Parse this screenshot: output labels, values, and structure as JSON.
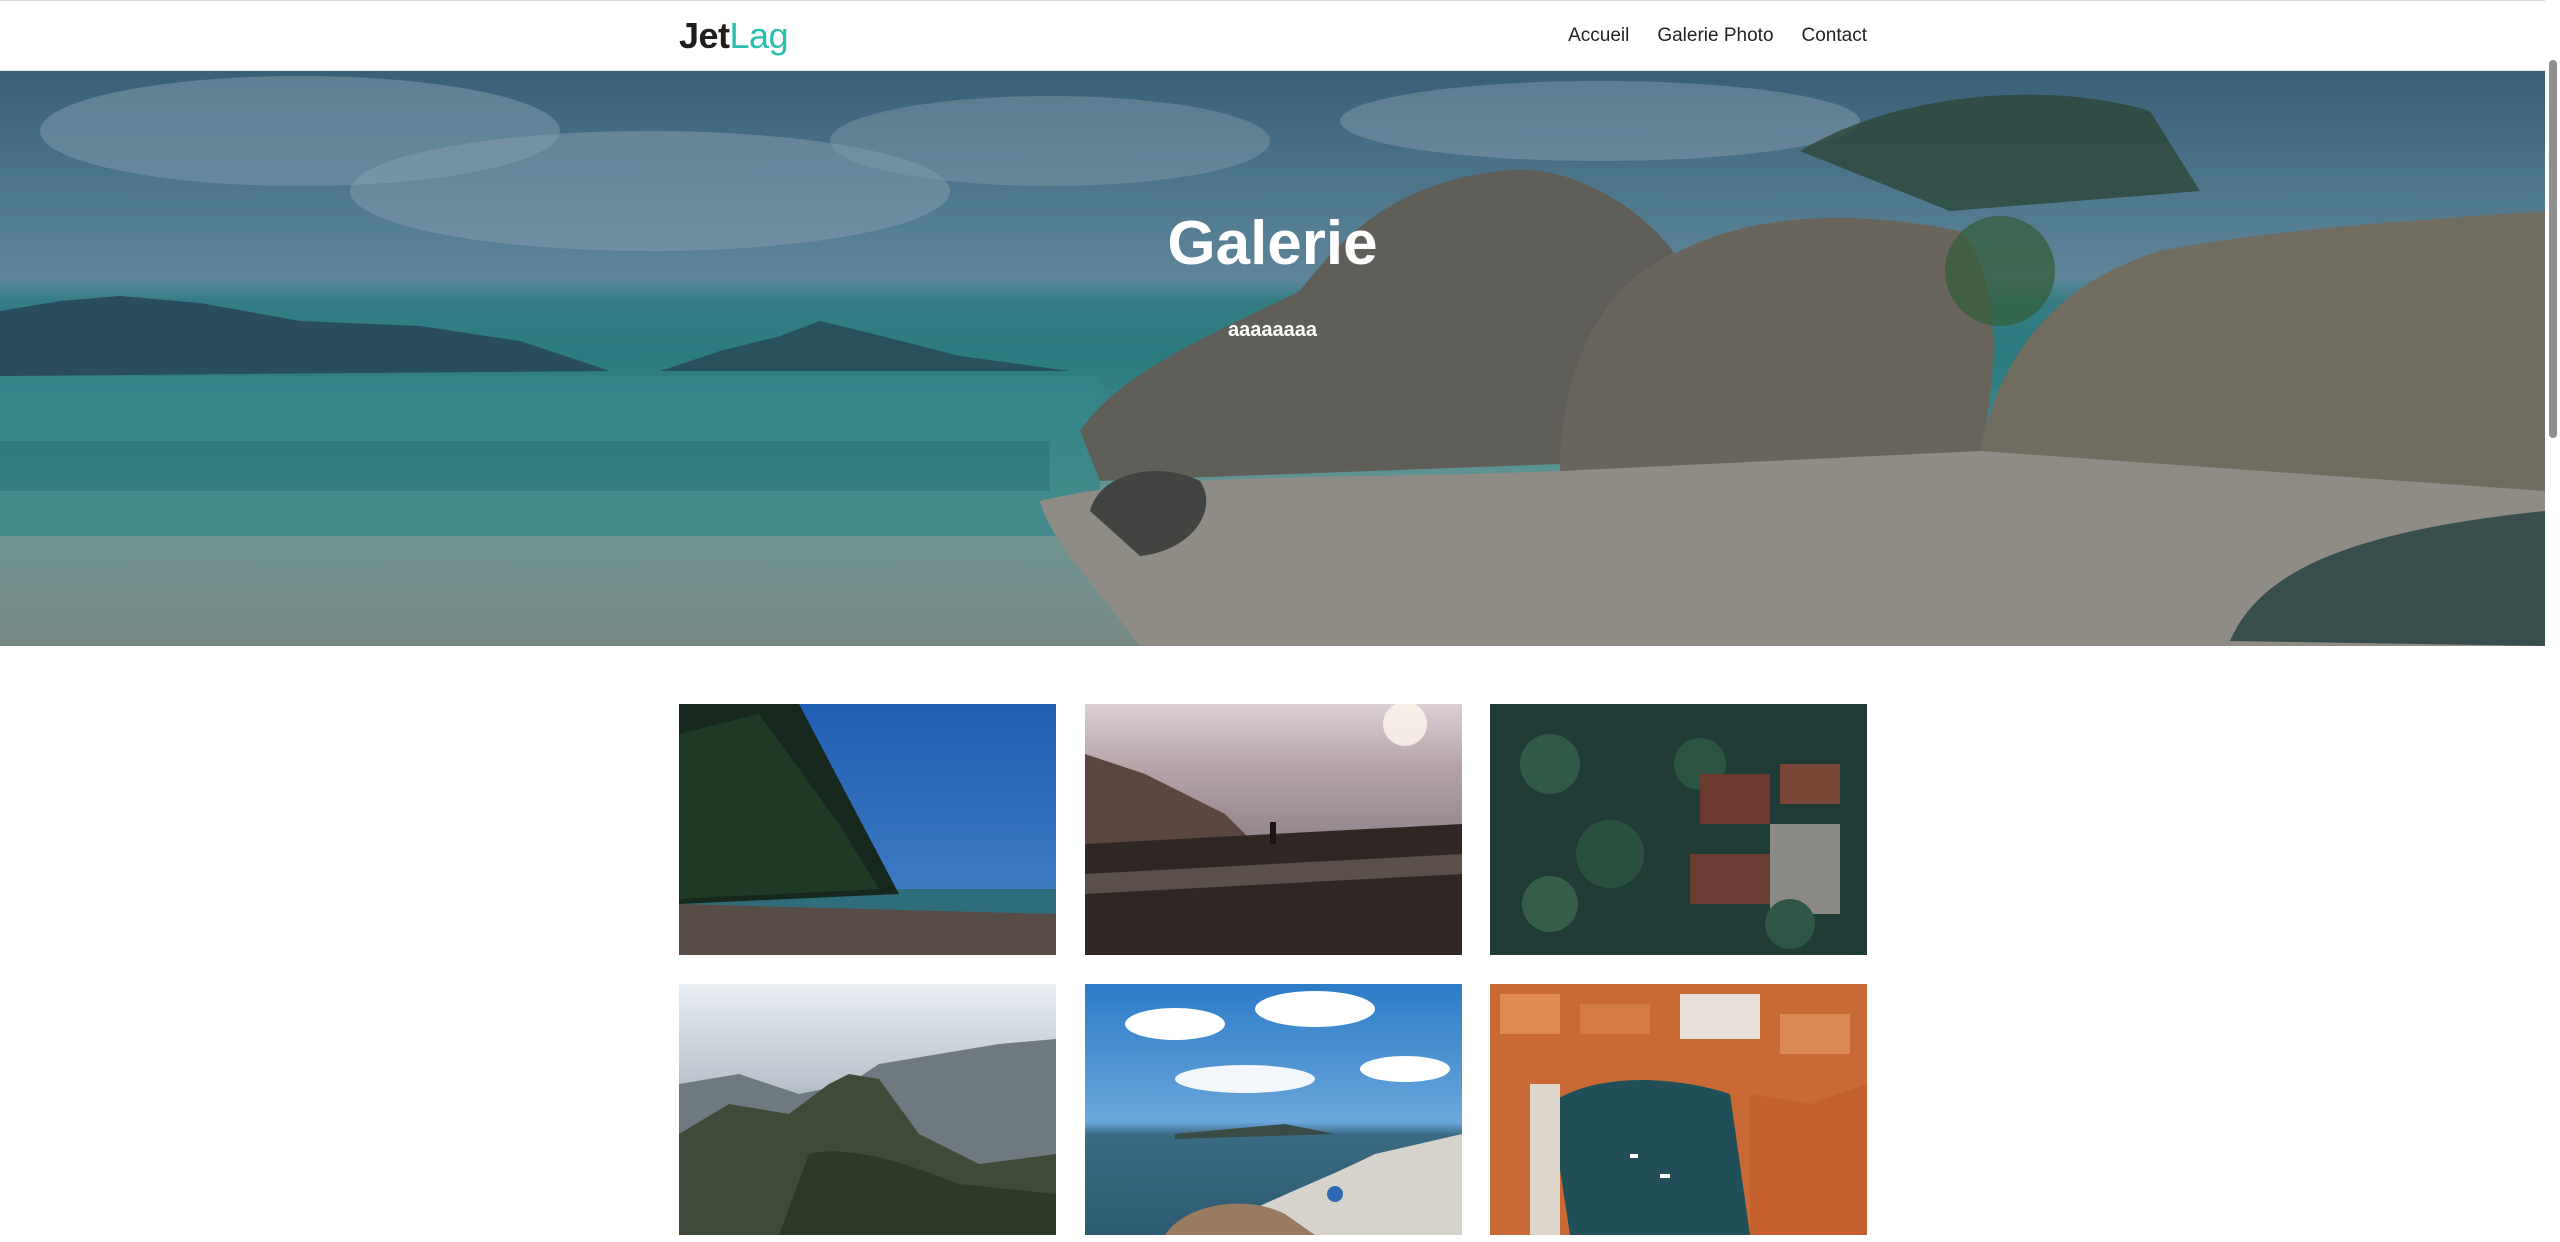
{
  "header": {
    "logo_part1": "Jet",
    "logo_part2": "Lag",
    "nav": [
      {
        "label": "Accueil"
      },
      {
        "label": "Galerie Photo"
      },
      {
        "label": "Contact"
      }
    ]
  },
  "hero": {
    "title": "Galerie",
    "subtitle": "aaaaaaaa"
  },
  "gallery": {
    "photos": [
      {
        "icon": "palm-beach-photo"
      },
      {
        "icon": "cliff-viewpoint-photo"
      },
      {
        "icon": "aerial-palm-village-photo"
      },
      {
        "icon": "mountain-valley-photo"
      },
      {
        "icon": "coastal-village-photo"
      },
      {
        "icon": "aerial-harbor-city-photo"
      }
    ]
  },
  "colors": {
    "logo_accent": "#29bfae",
    "text": "#222222"
  }
}
